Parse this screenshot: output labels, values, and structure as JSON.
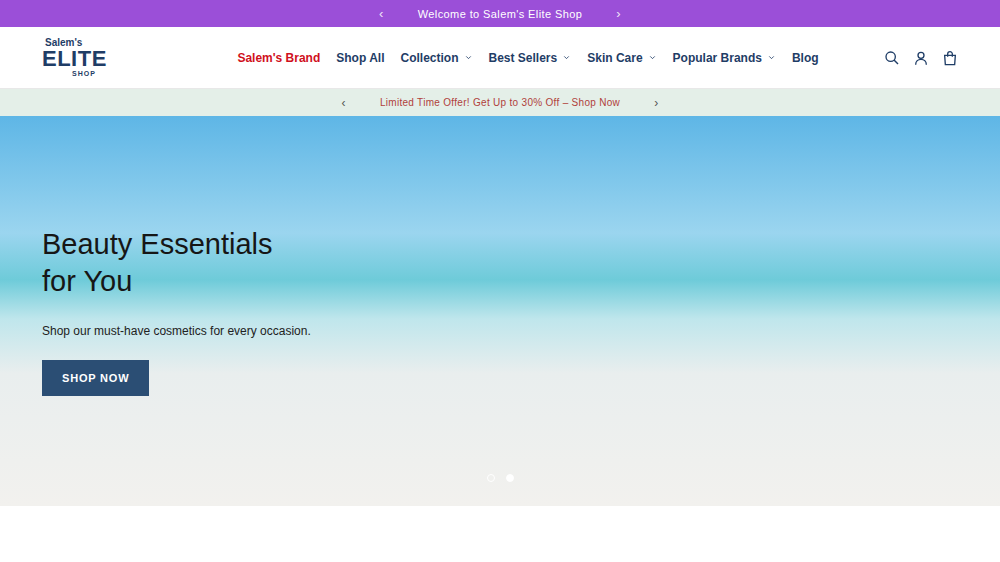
{
  "top_bar": {
    "prev": "‹",
    "text": "Welcome to Salem's Elite Shop",
    "next": "›"
  },
  "logo": {
    "line1": "Salem's",
    "line2": "ELITE",
    "line3": "SHOP"
  },
  "nav": [
    {
      "label": "Salem's Brand",
      "selected": true,
      "dropdown": false
    },
    {
      "label": "Shop All",
      "selected": false,
      "dropdown": false
    },
    {
      "label": "Collection",
      "selected": false,
      "dropdown": true
    },
    {
      "label": "Best Sellers",
      "selected": false,
      "dropdown": true
    },
    {
      "label": "Skin Care",
      "selected": false,
      "dropdown": true
    },
    {
      "label": "Popular Brands",
      "selected": false,
      "dropdown": true
    },
    {
      "label": "Blog",
      "selected": false,
      "dropdown": false
    }
  ],
  "promo_bar": {
    "prev": "‹",
    "text": "Limited Time Offer! Get Up to 30% Off – Shop Now",
    "next": "›"
  },
  "hero": {
    "title_line1": "Beauty Essentials",
    "title_line2": "for You",
    "subtitle": "Shop our must-have cosmetics for every occasion.",
    "button": "SHOP NOW",
    "dots": [
      {
        "selected": false
      },
      {
        "selected": true
      }
    ]
  }
}
